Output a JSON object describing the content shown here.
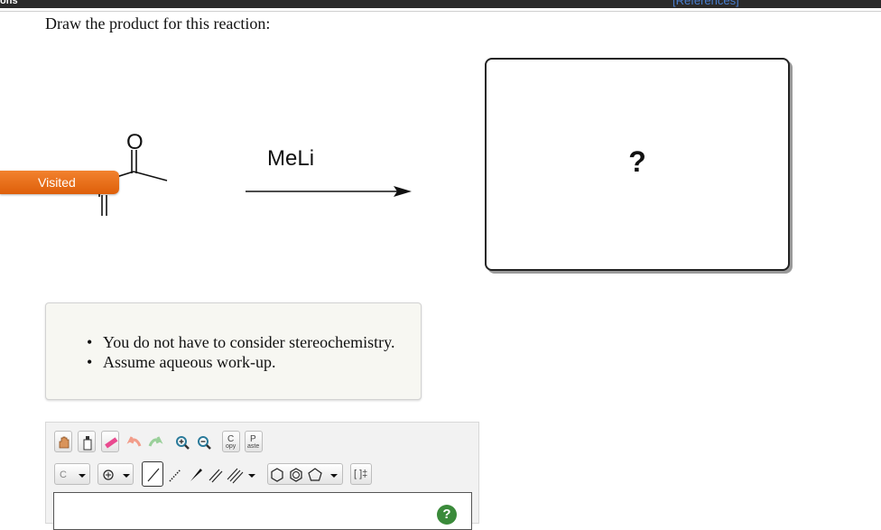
{
  "header": {
    "left_text": "ons",
    "references_link": "[References]"
  },
  "question": {
    "prompt": "Draw the product for this reaction:",
    "reagent": "MeLi",
    "reactant_atom_label": "O",
    "visited_badge": "Visited",
    "answer_placeholder": "?"
  },
  "hints": [
    "You do not have to consider stereochemistry.",
    "Assume aqueous work-up."
  ],
  "editor": {
    "copy_label": {
      "top": "C",
      "bottom": "opy"
    },
    "paste_label": {
      "top": "P",
      "bottom": "aste"
    },
    "atom_dropdown_value": "C",
    "bracket_label": "[ ]‡",
    "help_label": "?",
    "tools": [
      "hand-icon",
      "erase-bottle-icon",
      "eraser-icon",
      "undo-icon",
      "redo-icon",
      "zoom-in-icon",
      "zoom-out-icon",
      "copy",
      "paste",
      "atom-dropdown",
      "charge-icon",
      "single-bond-icon",
      "dashed-bond-icon",
      "wedge-bond-icon",
      "double-bond-icon",
      "triple-bond-icon",
      "hexagon-ring-icon",
      "benzene-ring-icon",
      "pentagon-ring-icon",
      "brackets-icon"
    ]
  }
}
